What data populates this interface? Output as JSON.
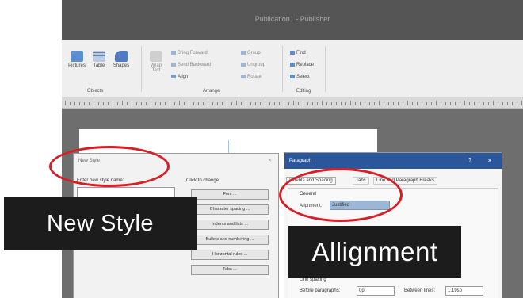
{
  "window": {
    "title": "Publication1 - Publisher"
  },
  "ribbon": {
    "objects": {
      "group_label": "Objects",
      "buttons": [
        {
          "label": "Pictures",
          "icon": "pictures-icon"
        },
        {
          "label": "Table",
          "icon": "table-icon"
        },
        {
          "label": "Shapes",
          "icon": "shapes-icon"
        }
      ]
    },
    "arrange": {
      "group_label": "Arrange",
      "wrap_text": "Wrap Text",
      "bring_forward": "Bring Forward",
      "send_backward": "Send Backward",
      "align": "Align",
      "group": "Group",
      "ungroup": "Ungroup",
      "rotate": "Rotate"
    },
    "editing": {
      "group_label": "Editing",
      "find": "Find",
      "replace": "Replace",
      "select": "Select"
    }
  },
  "new_style_dialog": {
    "title": "New Style",
    "name_label": "Enter new style name:",
    "click_to_change": "Click to change",
    "buttons": [
      "Font ...",
      "Character spacing ...",
      "Indents and lists ...",
      "Bullets and numbering ...",
      "Horizontal rules ...",
      "Tabs ..."
    ]
  },
  "paragraph_dialog": {
    "title": "Paragraph",
    "help": "?",
    "close": "✕",
    "tabs": [
      "Indents and Spacing",
      "Tabs",
      "Line and Paragraph Breaks"
    ],
    "general_label": "General",
    "alignment_label": "Alignment:",
    "alignment_value": "Justified",
    "line_spacing_label": "Line spacing",
    "before_paragraphs_label": "Before paragraphs:",
    "before_paragraphs_value": "0pt",
    "between_lines_label": "Between lines:",
    "between_lines_value": "1.19sp"
  },
  "overlays": {
    "new_style": "New Style",
    "alignment": "Allignment"
  },
  "colors": {
    "annotation_red": "#d81e24",
    "overlay_bg": "#1c1c1c",
    "dialog_title_blue": "#2b579a",
    "selection_blue": "#9db6d6"
  }
}
